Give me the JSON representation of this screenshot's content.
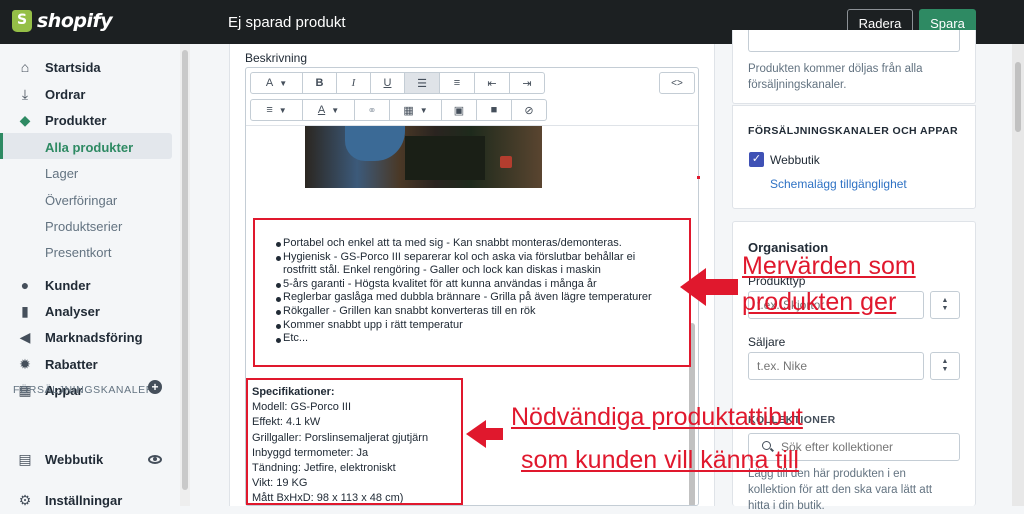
{
  "topbar": {
    "logo_text": "shopify",
    "page_title": "Ej sparad produkt",
    "delete_label": "Radera",
    "save_label": "Spara"
  },
  "sidebar": {
    "items": [
      {
        "label": "Startsida",
        "icon": "home-icon"
      },
      {
        "label": "Ordrar",
        "icon": "orders-icon"
      },
      {
        "label": "Produkter",
        "icon": "tag-icon"
      },
      {
        "label": "Alla produkter"
      },
      {
        "label": "Lager"
      },
      {
        "label": "Överföringar"
      },
      {
        "label": "Produktserier"
      },
      {
        "label": "Presentkort"
      },
      {
        "label": "Kunder",
        "icon": "person-icon"
      },
      {
        "label": "Analyser",
        "icon": "bar-chart-icon"
      },
      {
        "label": "Marknadsföring",
        "icon": "megaphone-icon"
      },
      {
        "label": "Rabatter",
        "icon": "discount-icon"
      },
      {
        "label": "Appar",
        "icon": "apps-icon"
      }
    ],
    "channels_heading": "FÖRSÄLJNINGSKANALER",
    "channel_webshop": "Webbutik",
    "settings": "Inställningar"
  },
  "editor": {
    "label": "Beskrivning",
    "toolbar": {
      "bold": "B",
      "italic": "I",
      "underline": "U",
      "code": "<>"
    },
    "bullets": [
      "Portabel och enkel att ta med sig - Kan snabbt monteras/demonteras.",
      "Hygienisk - GS-Porco III separerar kol och aska via förslutbar behållar ei",
      "rostfritt stål. Enkel rengöring - Galler och lock kan diskas i maskin",
      "5-års garanti - Högsta kvalitet för att kunna användas i många år",
      "Reglerbar gaslåga med dubbla brännare - Grilla på även lägre temperaturer",
      "Rökgaller - Grillen kan snabbt konverteras till en rök",
      "Kommer snabbt upp i rätt temperatur",
      "Etc..."
    ],
    "spec_title": "Specifikationer:",
    "spec_lines": [
      "Modell: GS-Porco III",
      "Effekt: 4.1 kW",
      "Grillgaller: Porslinsemaljerat gjutjärn",
      "Inbyggd termometer: Ja",
      "Tändning: Jetfire, elektroniskt",
      "Vikt: 19 KG",
      "Mått BxHxD: 98 x 113 x 48 cm)"
    ]
  },
  "annotations": {
    "top_line1": "Mervärden som",
    "top_line2": "produkten ger",
    "bottom_line1": "Nödvändiga produktattibut",
    "bottom_line2": "som kunden vill känna till"
  },
  "right": {
    "hidden_note_line1": "Produkten kommer döljas från alla",
    "hidden_note_line2": "försäljningskanaler.",
    "channels_heading": "FÖRSÄLJNINGSKANALER OCH APPAR",
    "webshop": "Webbutik",
    "schedule_link": "Schemalägg tillgänglighet",
    "org_title": "Organisation",
    "product_type_label": "Produkttyp",
    "product_type_placeholder": "t.ex. Skjortor",
    "vendor_label": "Säljare",
    "vendor_placeholder": "t.ex. Nike",
    "collections_label": "KOLLEKTIONER",
    "collections_placeholder": "Sök efter kollektioner",
    "collections_help_line1": "Lägg till den här produkten i en",
    "collections_help_line2": "kollektion för att den ska vara lätt att",
    "collections_help_line3": "hitta i din butik."
  },
  "colors": {
    "accent": "#2e8a63",
    "annotation": "#e0182d",
    "topbar": "#1c2022",
    "link": "#2f72c4"
  }
}
